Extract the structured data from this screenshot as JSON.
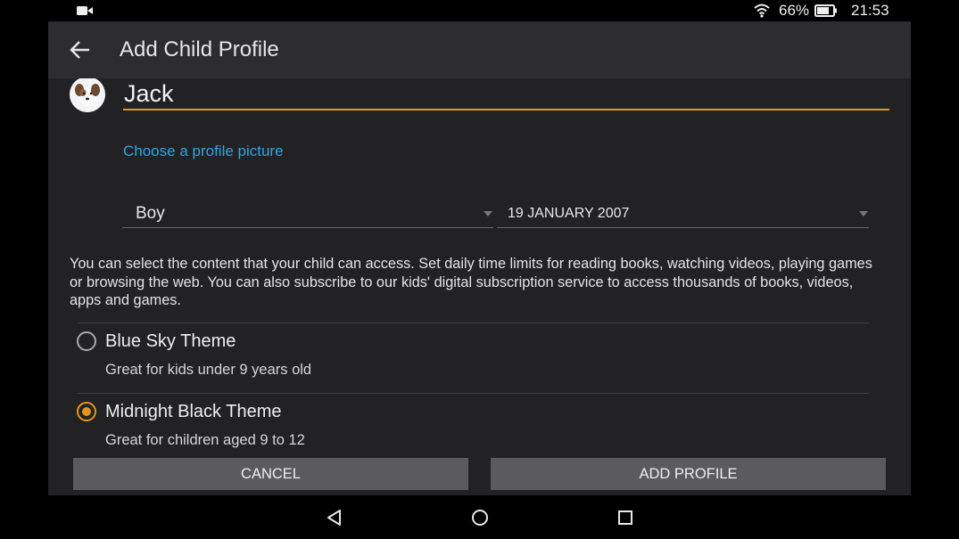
{
  "status_bar": {
    "battery_percent": "66%",
    "time": "21:53",
    "icons": [
      "video-camera-icon",
      "wifi-icon",
      "battery-icon"
    ]
  },
  "header": {
    "title": "Add Child Profile",
    "back_icon": "arrow-left-icon"
  },
  "profile": {
    "avatar_icon": "dog-avatar",
    "name_value": "Jack",
    "choose_picture_label": "Choose a profile picture"
  },
  "selects": {
    "gender": "Boy",
    "date_of_birth": "19 JANUARY 2007"
  },
  "description": "You can select the content that your child can access. Set daily time limits for reading books, watching videos, playing games or browsing the web. You can also subscribe to our kids' digital subscription service to access thousands of books, videos, apps and games.",
  "themes": [
    {
      "title": "Blue Sky Theme",
      "subtitle": "Great for kids under 9 years old",
      "selected": false
    },
    {
      "title": "Midnight Black Theme",
      "subtitle": "Great for children aged 9 to 12",
      "selected": true
    }
  ],
  "buttons": {
    "cancel": "CANCEL",
    "add_profile": "ADD PROFILE"
  },
  "colors": {
    "accent": "#e4951e",
    "link": "#2ba5e6",
    "background": "#222224",
    "app_bar": "#2d2d2f",
    "button": "#5b5b5e"
  },
  "nav_bar": {
    "icons": [
      "back-triangle-icon",
      "home-circle-icon",
      "recents-square-icon"
    ]
  }
}
